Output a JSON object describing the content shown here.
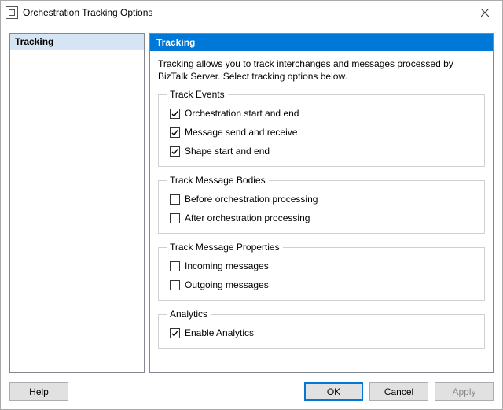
{
  "window": {
    "title": "Orchestration Tracking Options"
  },
  "sidebar": {
    "items": [
      {
        "label": "Tracking"
      }
    ]
  },
  "panel": {
    "header": "Tracking",
    "description": "Tracking allows you to track interchanges and messages processed by BizTalk Server. Select tracking options below."
  },
  "groups": {
    "events": {
      "legend": "Track Events",
      "items": [
        {
          "label": "Orchestration start and end",
          "checked": true
        },
        {
          "label": "Message send and receive",
          "checked": true
        },
        {
          "label": "Shape start and end",
          "checked": true
        }
      ]
    },
    "bodies": {
      "legend": "Track Message Bodies",
      "items": [
        {
          "label": "Before orchestration processing",
          "checked": false
        },
        {
          "label": "After orchestration processing",
          "checked": false
        }
      ]
    },
    "properties": {
      "legend": "Track Message Properties",
      "items": [
        {
          "label": "Incoming messages",
          "checked": false
        },
        {
          "label": "Outgoing messages",
          "checked": false
        }
      ]
    },
    "analytics": {
      "legend": "Analytics",
      "items": [
        {
          "label": "Enable Analytics",
          "checked": true
        }
      ]
    }
  },
  "buttons": {
    "help": "Help",
    "ok": "OK",
    "cancel": "Cancel",
    "apply": "Apply"
  }
}
